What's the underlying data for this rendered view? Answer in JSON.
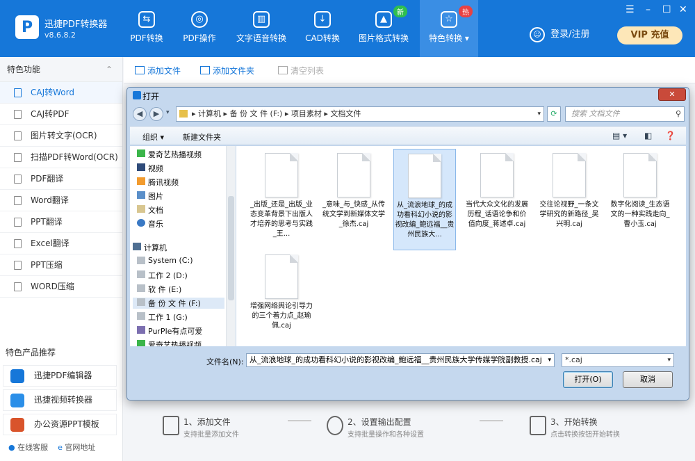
{
  "app": {
    "name": "迅捷PDF转换器",
    "version": "v8.6.8.2",
    "logo_letter": "P",
    "brand_color": "#1677d9"
  },
  "nav": [
    {
      "label": "PDF转换",
      "icon": "pdf-convert-icon"
    },
    {
      "label": "PDF操作",
      "icon": "pdf-operate-icon"
    },
    {
      "label": "文字语音转换",
      "icon": "text-speech-icon"
    },
    {
      "label": "CAD转换",
      "icon": "cad-convert-icon"
    },
    {
      "label": "图片格式转换",
      "icon": "image-format-icon",
      "badge": "新"
    },
    {
      "label": "特色转换",
      "icon": "feature-convert-icon",
      "badge": "热",
      "active": true
    }
  ],
  "header": {
    "login": "登录/注册",
    "vip": "VIP 充值"
  },
  "sidebar": {
    "title": "特色功能",
    "items": [
      {
        "label": "CAJ转Word",
        "selected": true
      },
      {
        "label": "CAJ转PDF"
      },
      {
        "label": "图片转文字(OCR)"
      },
      {
        "label": "扫描PDF转Word(OCR)"
      },
      {
        "label": "PDF翻译"
      },
      {
        "label": "Word翻译"
      },
      {
        "label": "PPT翻译"
      },
      {
        "label": "Excel翻译"
      },
      {
        "label": "PPT压缩"
      },
      {
        "label": "WORD压缩"
      }
    ],
    "products_title": "特色产品推荐",
    "products": [
      "迅捷PDF编辑器",
      "迅捷视频转换器",
      "办公资源PPT模板"
    ],
    "support": "在线客服",
    "website": "官网地址"
  },
  "toolbar": {
    "add_file": "添加文件",
    "add_folder": "添加文件夹",
    "clear_list": "清空列表"
  },
  "steps": [
    {
      "title": "1、添加文件",
      "sub": "支持批量添加文件"
    },
    {
      "title": "2、设置输出配置",
      "sub": "支持批量操作和各种设置"
    },
    {
      "title": "3、开始转换",
      "sub": "点击转换按钮开始转换"
    }
  ],
  "dialog": {
    "title": "打开",
    "breadcrumb": [
      "计算机",
      "备 份 文 件 (F:)",
      "项目素材",
      "文档文件"
    ],
    "search_placeholder": "搜索 文档文件",
    "organize": "组织 ▾",
    "new_folder": "新建文件夹",
    "nav_items": [
      "爱奇艺热播视频",
      "视频",
      "腾讯视频",
      "图片",
      "文档",
      "音乐",
      "计算机",
      "System (C:)",
      "工作 2 (D:)",
      "软 件 (E:)",
      "备 份 文 件 (F:)",
      "工作 1 (G:)",
      "PurPle有点可爱",
      "爱奇艺热播视频"
    ],
    "files": [
      "_出版_还是_出版_业态变革背景下出版人才培养的思考与实践_王...",
      "_意味_与_快感_从传统文学到新媒体文学_徐杰.caj",
      "从_流浪地球_的成功看科幻小说的影视改编_鲍远福__贵州民族大...",
      "当代大众文化的发展历程_话语论争和价值向度_蒋述卓.caj",
      "交往论视野_一条文学研究的新路径_吴兴明.caj",
      "数字化阅读_生态语文的一种实践走向_曹小玉.caj",
      "增强网络舆论引导力的三个着力点_赵瑜佩.caj"
    ],
    "selected_file": 2,
    "filename_label": "文件名(N):",
    "filename_value": "从_流浪地球_的成功看科幻小说的影视改编_鲍远福__贵州民族大学传媒学院副教授.caj",
    "filetype_value": "*.caj",
    "open_button": "打开(O)",
    "cancel_button": "取消"
  }
}
